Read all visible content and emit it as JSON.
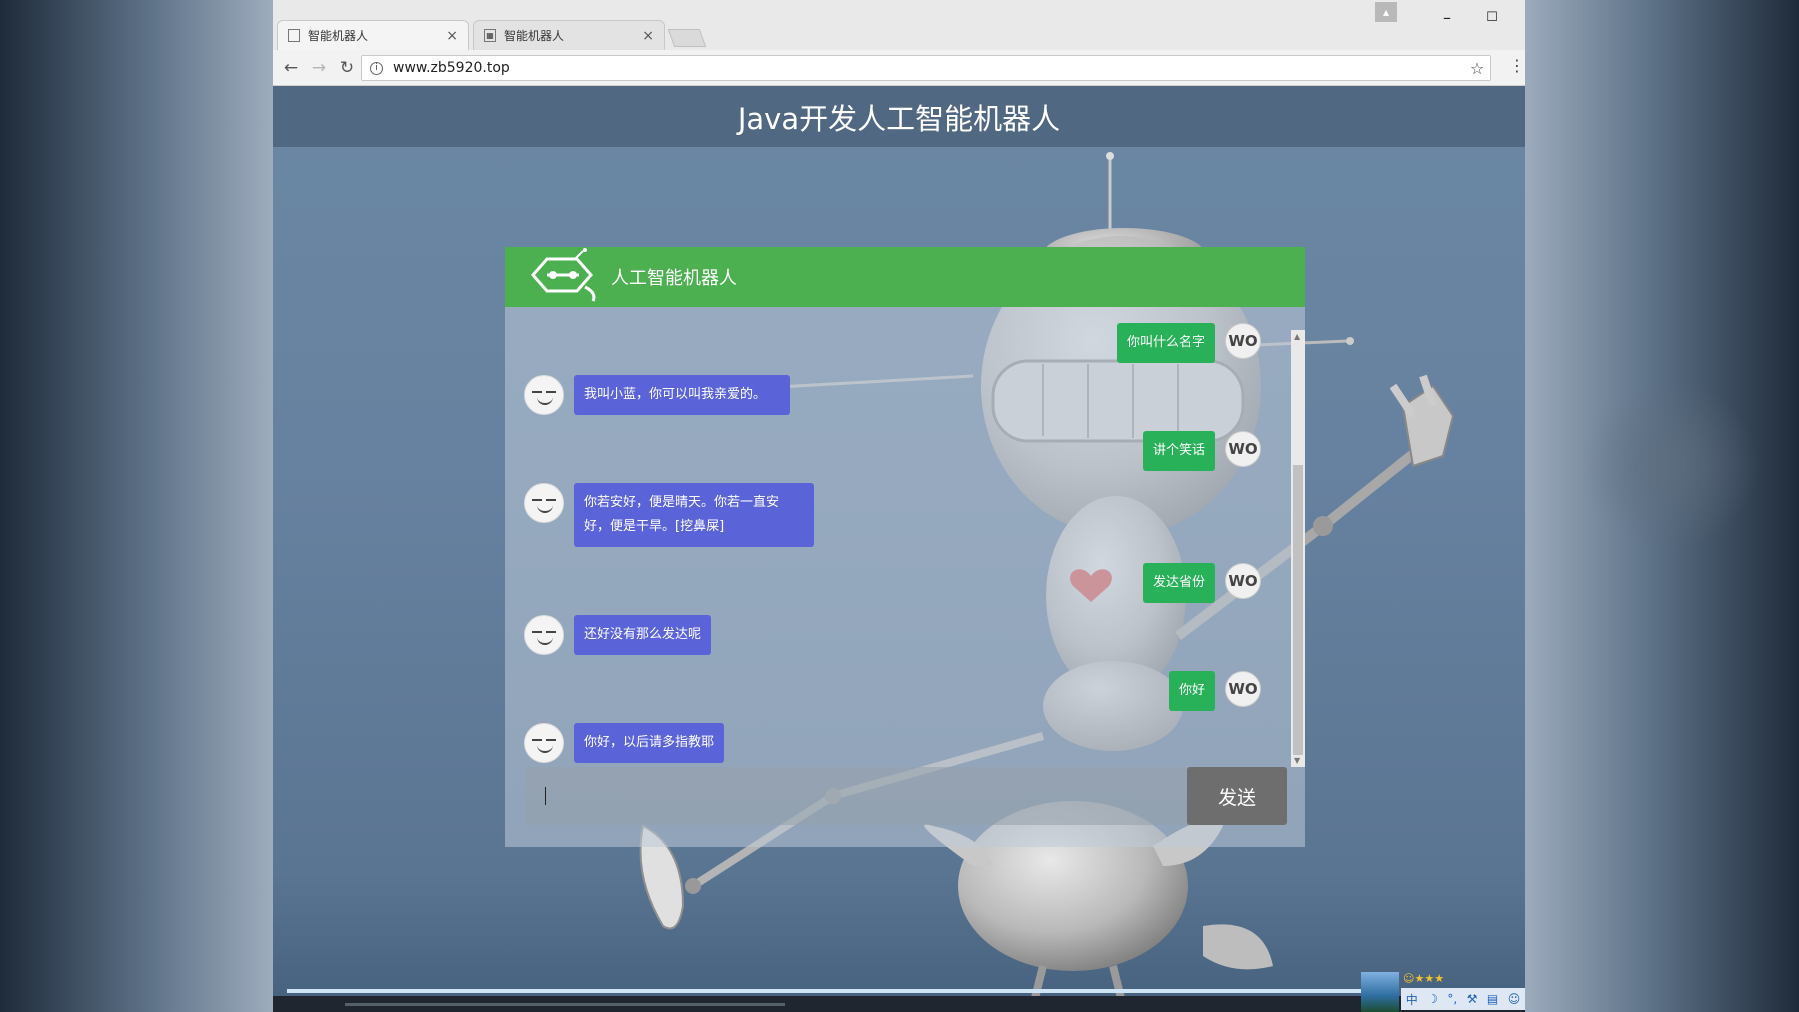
{
  "browser": {
    "tabs": [
      {
        "label": "智能机器人",
        "close": "×",
        "active": true
      },
      {
        "label": "智能机器人",
        "close": "×",
        "active": false
      }
    ],
    "url": "www.zb5920.top",
    "window_controls": {
      "minimize": "–",
      "maximize": "☐",
      "close": "✕"
    }
  },
  "page": {
    "title": "Java开发人工智能机器人"
  },
  "chat": {
    "header_title": "人工智能机器人",
    "send_label": "发送",
    "input_value": "",
    "me_avatar_label": "WO",
    "messages": [
      {
        "from": "me",
        "text": "你叫什么名字"
      },
      {
        "from": "bot",
        "text": "我叫小蓝，你可以叫我亲爱的。"
      },
      {
        "from": "me",
        "text": "讲个笑话"
      },
      {
        "from": "bot",
        "text": "你若安好，便是晴天。你若一直安好，便是干旱。[挖鼻屎]"
      },
      {
        "from": "me",
        "text": "发达省份"
      },
      {
        "from": "bot",
        "text": "还好没有那么发达呢"
      },
      {
        "from": "me",
        "text": "你好"
      },
      {
        "from": "bot",
        "text": "你好，以后请多指教耶"
      }
    ]
  },
  "colors": {
    "header_green": "#4caf50",
    "bot_bubble": "#5b63d8",
    "me_bubble": "#28b159",
    "page_header": "#506882"
  }
}
